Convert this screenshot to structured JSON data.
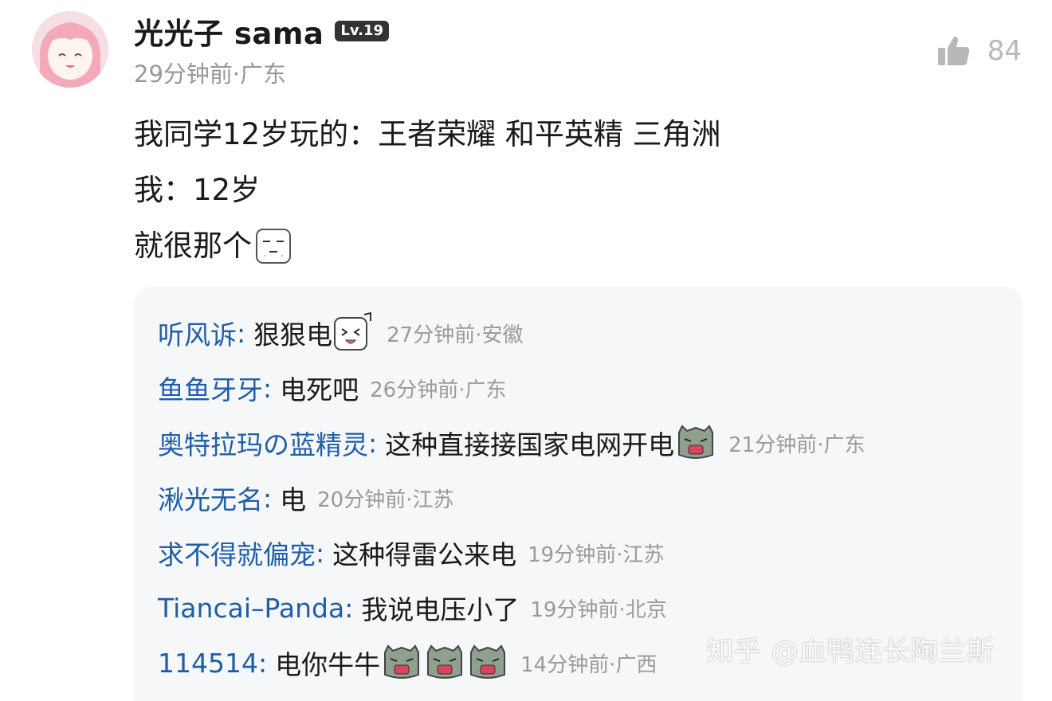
{
  "post": {
    "author": "光光子 sama",
    "level": "Lv.19",
    "meta": "29分钟前·广东",
    "likes": "84",
    "lines": [
      "我同学12岁玩的：王者荣耀 和平英精 三角洲",
      "我：12岁",
      "就很那个"
    ]
  },
  "replies": [
    {
      "name": "听风诉",
      "text": "狠狠电",
      "time": "27分钟前·安徽",
      "emoji": "wink-music-emoji"
    },
    {
      "name": "鱼鱼牙牙",
      "text": "电死吧",
      "time": "26分钟前·广东"
    },
    {
      "name": "奥特拉玛の蓝精灵",
      "text": "这种直接接国家电网开电",
      "time": "21分钟前·广东",
      "emoji": "green-angry-emoji"
    },
    {
      "name": "湫光无名",
      "text": "电",
      "time": "20分钟前·江苏"
    },
    {
      "name": "求不得就偏宠",
      "text": "这种得雷公来电",
      "time": "19分钟前·江苏"
    },
    {
      "name": "Tiancai–Panda",
      "text": "我说电压小了",
      "time": "19分钟前·北京"
    },
    {
      "name": "114514",
      "text": "电你牛牛",
      "time": "14分钟前·广西",
      "emoji": "green-angry-emoji x3"
    }
  ],
  "watermark": "知乎 @血鸭连长陶兰斯",
  "colors": {
    "name_blue": "#1f5ea8",
    "reply_bg": "#f6f7f9",
    "meta_gray": "#999999"
  }
}
